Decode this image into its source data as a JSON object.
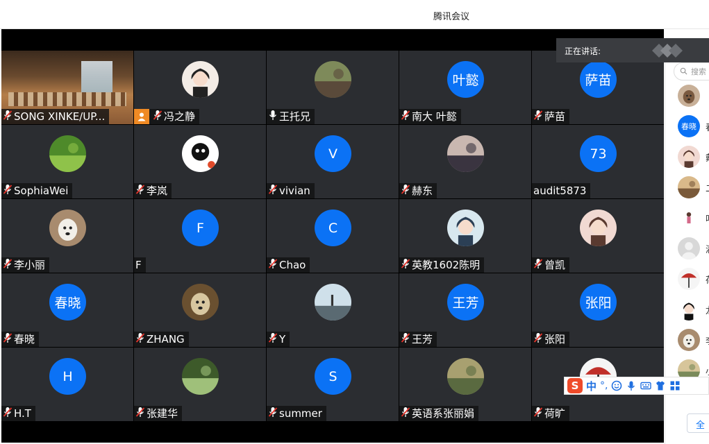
{
  "window": {
    "title": "腾讯会议"
  },
  "speaking": {
    "label": "正在讲话:"
  },
  "grid": {
    "tiles": [
      {
        "name": "SONG XINKE/UP...",
        "avatar_type": "video",
        "muted": true
      },
      {
        "name": "冯之静",
        "avatar_type": "photo",
        "photo": "girl-white",
        "muted": true,
        "host": true
      },
      {
        "name": "王托兄",
        "avatar_type": "photo",
        "photo": "building",
        "muted": false
      },
      {
        "name": "南大 叶懿",
        "avatar_type": "letter",
        "letter": "叶懿",
        "muted": true
      },
      {
        "name": "萨苗",
        "avatar_type": "letter",
        "letter": "萨苗",
        "muted": true
      },
      {
        "name": "SophiaWei",
        "avatar_type": "photo",
        "photo": "leaves",
        "muted": true
      },
      {
        "name": "李岚",
        "avatar_type": "photo",
        "photo": "cartoon-bw",
        "muted": true
      },
      {
        "name": "vivian",
        "avatar_type": "letter",
        "letter": "V",
        "muted": true
      },
      {
        "name": "赫东",
        "avatar_type": "photo",
        "photo": "baby",
        "muted": true
      },
      {
        "name": "audit5873",
        "avatar_type": "letter",
        "letter": "73",
        "muted": false,
        "nomic": true
      },
      {
        "name": "李小丽",
        "avatar_type": "photo",
        "photo": "dog",
        "muted": true
      },
      {
        "name": "F",
        "avatar_type": "letter",
        "letter": "F",
        "muted": false,
        "nomic": true
      },
      {
        "name": "Chao",
        "avatar_type": "letter",
        "letter": "C",
        "muted": true
      },
      {
        "name": "英教1602陈明",
        "avatar_type": "photo",
        "photo": "anime-girl",
        "muted": true
      },
      {
        "name": "曾凯",
        "avatar_type": "photo",
        "photo": "cartoon-girl",
        "muted": true
      },
      {
        "name": "春晓",
        "avatar_type": "letter",
        "letter": "春晓",
        "muted": true
      },
      {
        "name": "ZHANG",
        "avatar_type": "photo",
        "photo": "monkey",
        "muted": true
      },
      {
        "name": "Y",
        "avatar_type": "photo",
        "photo": "sea",
        "muted": true
      },
      {
        "name": "王芳",
        "avatar_type": "letter",
        "letter": "王芳",
        "muted": true
      },
      {
        "name": "张阳",
        "avatar_type": "letter",
        "letter": "张阳",
        "muted": true
      },
      {
        "name": "H.T",
        "avatar_type": "letter",
        "letter": "H",
        "muted": true
      },
      {
        "name": "张建华",
        "avatar_type": "photo",
        "photo": "forest",
        "muted": true
      },
      {
        "name": "summer",
        "avatar_type": "letter",
        "letter": "S",
        "muted": true
      },
      {
        "name": "英语系张丽娟",
        "avatar_type": "photo",
        "photo": "field",
        "muted": true
      },
      {
        "name": "荷旷",
        "avatar_type": "photo",
        "photo": "umbrella",
        "muted": true
      }
    ]
  },
  "side_panel": {
    "search_placeholder": "搜索",
    "participants": [
      {
        "type": "photo",
        "photo": "dog-top"
      },
      {
        "type": "letter",
        "letter": "春晓",
        "name_partial": "春"
      },
      {
        "type": "photo",
        "photo": "cartoon-girl",
        "name_partial": "戴"
      },
      {
        "type": "photo",
        "photo": "baby2",
        "name_partial": "二"
      },
      {
        "type": "photo",
        "photo": "small-figure",
        "name_partial": "叶"
      },
      {
        "type": "photo",
        "photo": "default",
        "name_partial": "满"
      },
      {
        "type": "photo",
        "photo": "umbrella",
        "name_partial": "荷"
      },
      {
        "type": "photo",
        "photo": "girl-dark",
        "name_partial": "龙"
      },
      {
        "type": "photo",
        "photo": "dog",
        "name_partial": "李"
      },
      {
        "type": "photo",
        "photo": "crowd",
        "name_partial": "小"
      }
    ],
    "all_button": "全"
  },
  "ime": {
    "logo": "S",
    "mode": "中",
    "punct": "°,"
  },
  "colors": {
    "avatar_blue": "#0b72f5",
    "tile_bg": "#2b2d31",
    "host_orange": "#f08a24",
    "ime_red": "#ef4b2a"
  }
}
